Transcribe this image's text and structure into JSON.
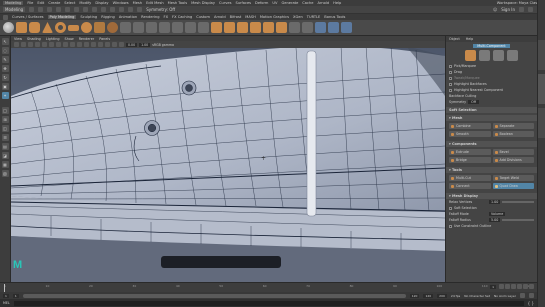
{
  "menubar": {
    "workspace": "Modeling",
    "items": [
      "File",
      "Edit",
      "Create",
      "Select",
      "Modify",
      "Display",
      "Windows",
      "Mesh",
      "Edit Mesh",
      "Mesh Tools",
      "Mesh Display",
      "Curves",
      "Surfaces",
      "Deform",
      "UV",
      "Generate",
      "Cache",
      "Arnold",
      "Help"
    ],
    "right": "Workspace: Maya Classic"
  },
  "statusline": {
    "mode": "Modeling",
    "symmetry": "Symmetry: Off",
    "signin": "Sign In"
  },
  "shelf": {
    "tabs": [
      "Curves / Surfaces",
      "Poly Modeling",
      "Sculpting",
      "Rigging",
      "Animation",
      "Rendering",
      "FX",
      "FX Caching",
      "Custom",
      "Arnold",
      "Bifrost",
      "MASH",
      "Motion Graphics",
      "XGen",
      "TURTLE",
      "Bonus Tools"
    ],
    "active_tab": "Poly Modeling"
  },
  "panel": {
    "menus": [
      "View",
      "Shading",
      "Lighting",
      "Show",
      "Renderer",
      "Panels"
    ],
    "gamma": "sRGB gamma",
    "val1": "0.00",
    "val2": "1.00"
  },
  "mdt": {
    "menus": [
      "Object",
      "Help"
    ],
    "selection_mode": "Multi-Component",
    "options": [
      "Pick/Marquee",
      "Drag",
      "Tweak/Marquee",
      "Highlight Backfaces",
      "Highlight Nearest Component"
    ],
    "backface_culling": "Backface Culling",
    "symmetry_label": "Symmetry",
    "symmetry_value": "Off",
    "soft_selection": "Soft Selection",
    "sections": {
      "mesh": "Mesh",
      "components": "Components",
      "tools": "Tools",
      "mesh_display": "Mesh Display"
    },
    "mesh_buttons": [
      "Combine",
      "Separate",
      "Smooth",
      "Boolean"
    ],
    "component_buttons": [
      "Extrude",
      "Bevel",
      "Bridge",
      "Add Divisions"
    ],
    "tool_buttons": [
      "Multi-Cut",
      "Target Weld",
      "Connect",
      "Quad Draw"
    ],
    "settings": [
      {
        "label": "Relax Vertices",
        "value": "1.00"
      },
      {
        "label": "Soft Selection",
        "value": ""
      },
      {
        "label": "Falloff Mode",
        "value": "Volume"
      },
      {
        "label": "Falloff Radius",
        "value": "5.00"
      }
    ],
    "use_constraint": "Use Constraint Outline"
  },
  "timeline": {
    "ticks": [
      "1",
      "10",
      "20",
      "30",
      "40",
      "50",
      "60",
      "70",
      "80",
      "90",
      "100",
      "110",
      "120"
    ],
    "current": "1"
  },
  "rangebar": {
    "start": "1",
    "start2": "1",
    "end": "120",
    "end2": "120",
    "end3": "200",
    "character": "No Character Set",
    "anim_layer": "No Anim Layer",
    "fps": "24 fps"
  },
  "cmdline": {
    "lang": "MEL"
  },
  "colors": {
    "viewport": "#6b7386",
    "mesh": "#bcc3d3",
    "wire": "#1a2438",
    "accent": "#5285a6"
  }
}
